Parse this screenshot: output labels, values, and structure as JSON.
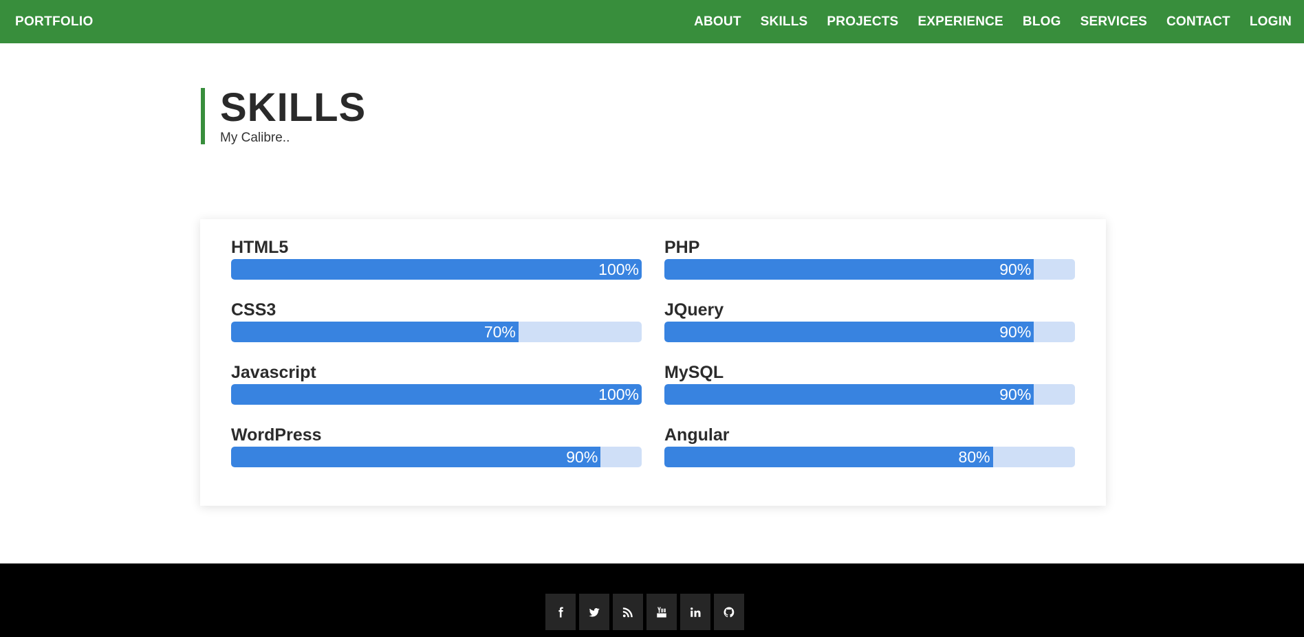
{
  "nav": {
    "brand": "PORTFOLIO",
    "links": [
      "ABOUT",
      "SKILLS",
      "PROJECTS",
      "EXPERIENCE",
      "BLOG",
      "SERVICES",
      "CONTACT",
      "LOGIN"
    ]
  },
  "section": {
    "title": "SKILLS",
    "subtitle": "My Calibre.."
  },
  "skills": [
    {
      "name": "HTML5",
      "percent": 100,
      "label": "100%"
    },
    {
      "name": "PHP",
      "percent": 90,
      "label": "90%"
    },
    {
      "name": "CSS3",
      "percent": 70,
      "label": "70%"
    },
    {
      "name": "JQuery",
      "percent": 90,
      "label": "90%"
    },
    {
      "name": "Javascript",
      "percent": 100,
      "label": "100%"
    },
    {
      "name": "MySQL",
      "percent": 90,
      "label": "90%"
    },
    {
      "name": "WordPress",
      "percent": 90,
      "label": "90%"
    },
    {
      "name": "Angular",
      "percent": 80,
      "label": "80%"
    }
  ],
  "footer": {
    "social": [
      "facebook-icon",
      "twitter-icon",
      "rss-icon",
      "youtube-icon",
      "linkedin-icon",
      "github-icon"
    ]
  },
  "colors": {
    "nav_green": "#388e3c",
    "bar_fill": "#3883e0",
    "bar_track": "#cfdff7",
    "footer_bg": "#000000"
  }
}
